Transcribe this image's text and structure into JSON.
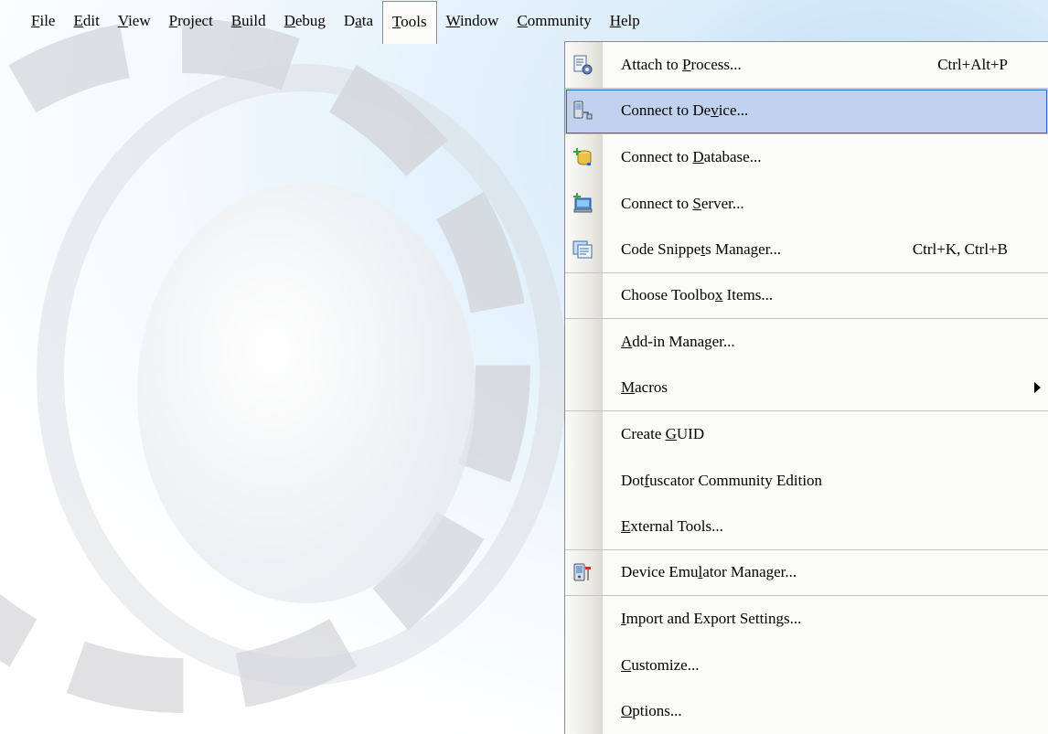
{
  "menubar": {
    "items": [
      {
        "pre": "",
        "acc": "F",
        "post": "ile"
      },
      {
        "pre": "",
        "acc": "E",
        "post": "dit"
      },
      {
        "pre": "",
        "acc": "V",
        "post": "iew"
      },
      {
        "pre": "",
        "acc": "P",
        "post": "roject"
      },
      {
        "pre": "",
        "acc": "B",
        "post": "uild"
      },
      {
        "pre": "",
        "acc": "D",
        "post": "ebug"
      },
      {
        "pre": "D",
        "acc": "a",
        "post": "ta"
      },
      {
        "pre": "",
        "acc": "T",
        "post": "ools"
      },
      {
        "pre": "",
        "acc": "W",
        "post": "indow"
      },
      {
        "pre": "",
        "acc": "C",
        "post": "ommunity"
      },
      {
        "pre": "",
        "acc": "H",
        "post": "elp"
      }
    ]
  },
  "tools_menu": {
    "items": [
      {
        "pre": "Attach to ",
        "acc": "P",
        "post": "rocess...",
        "shortcut": "Ctrl+Alt+P",
        "icon": "attach-process-icon"
      },
      {
        "pre": "Connect to De",
        "acc": "v",
        "post": "ice...",
        "shortcut": "",
        "icon": "connect-device-icon"
      },
      {
        "pre": "Connect to ",
        "acc": "D",
        "post": "atabase...",
        "shortcut": "",
        "icon": "connect-database-icon"
      },
      {
        "pre": "Connect to ",
        "acc": "S",
        "post": "erver...",
        "shortcut": "",
        "icon": "connect-server-icon"
      },
      {
        "pre": "Code Snippe",
        "acc": "t",
        "post": "s Manager...",
        "shortcut": "Ctrl+K, Ctrl+B",
        "icon": "code-snippets-icon"
      },
      {
        "pre": "Choose Toolbo",
        "acc": "x",
        "post": " Items...",
        "shortcut": "",
        "icon": ""
      },
      {
        "pre": "",
        "acc": "A",
        "post": "dd-in Manager...",
        "shortcut": "",
        "icon": ""
      },
      {
        "pre": "",
        "acc": "M",
        "post": "acros",
        "shortcut": "",
        "icon": ""
      },
      {
        "pre": "Create ",
        "acc": "G",
        "post": "UID",
        "shortcut": "",
        "icon": ""
      },
      {
        "pre": "Dot",
        "acc": "f",
        "post": "uscator Community Edition",
        "shortcut": "",
        "icon": ""
      },
      {
        "pre": "",
        "acc": "E",
        "post": "xternal Tools...",
        "shortcut": "",
        "icon": ""
      },
      {
        "pre": "Device Emu",
        "acc": "l",
        "post": "ator Manager...",
        "shortcut": "",
        "icon": "device-emulator-icon"
      },
      {
        "pre": "",
        "acc": "I",
        "post": "mport and Export Settings...",
        "shortcut": "",
        "icon": ""
      },
      {
        "pre": "",
        "acc": "C",
        "post": "ustomize...",
        "shortcut": "",
        "icon": ""
      },
      {
        "pre": "",
        "acc": "O",
        "post": "ptions...",
        "shortcut": "",
        "icon": ""
      }
    ]
  },
  "colors": {
    "highlight_bg": "#c1d2ee",
    "highlight_border": "#316ac5",
    "menu_bg": "#fbfbf9"
  }
}
